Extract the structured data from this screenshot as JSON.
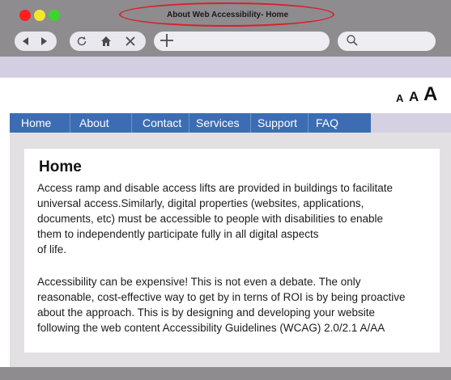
{
  "browser": {
    "window_title": "About Web Accessibility- Home",
    "traffic_lights": [
      "#ff1f1f",
      "#f3e630",
      "#3ad62b"
    ],
    "icons": {
      "back": "back-arrow-icon",
      "forward": "forward-arrow-icon",
      "reload": "reload-icon",
      "home": "home-icon",
      "close": "close-icon",
      "new_tab": "plus-icon",
      "search": "search-icon"
    }
  },
  "font_size_controls": [
    "A",
    "A",
    "A"
  ],
  "nav": {
    "items": [
      "Home",
      "About",
      "Contact",
      "Services",
      "Support",
      "FAQ"
    ],
    "accent": "#3c6db4"
  },
  "page": {
    "heading": "Home",
    "paragraph1_lines": [
      "Access ramp and disable access lifts are provided in buildings to facilitate",
      "universal access.Similarly, digital properties (websites, applications,",
      "documents, etc) must be accessible to people with disabilities to enable",
      "them to independently participate fully in all digital aspects",
      "of life."
    ],
    "paragraph2_lines": [
      "Accessibility can be expensive! This is not even a debate. The only",
      "reasonable, cost-effective way to get by in terns of ROI is by being proactive",
      "about the approach. This is by designing and developing your website",
      "following the web content Accessibility Guidelines (WCAG) 2.0/2.1 A/AA"
    ]
  }
}
